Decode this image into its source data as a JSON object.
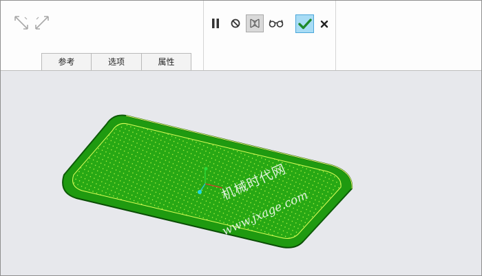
{
  "tabs": [
    {
      "label": "参考"
    },
    {
      "label": "选项"
    },
    {
      "label": "属性"
    }
  ],
  "toolbar": {
    "icons": [
      "arrow-expand-icon",
      "arrow-collapse-icon",
      "pause-icon",
      "no-preview-icon",
      "geometry-preview-icon",
      "glasses-icon",
      "confirm-check-icon",
      "cancel-x-icon"
    ]
  },
  "watermark": {
    "line1": "机械时代网",
    "line2": "www.jxage.com"
  },
  "colors": {
    "model_green": "#22a012",
    "accent_check": "#a8dcf5"
  }
}
